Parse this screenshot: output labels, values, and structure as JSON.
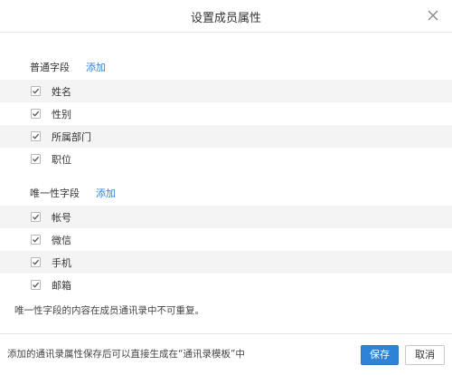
{
  "dialog": {
    "title": "设置成员属性"
  },
  "common_fields": {
    "heading": "普通字段",
    "add_label": "添加",
    "items": [
      {
        "label": "姓名",
        "checked": true
      },
      {
        "label": "性别",
        "checked": true
      },
      {
        "label": "所属部门",
        "checked": true
      },
      {
        "label": "职位",
        "checked": true
      }
    ]
  },
  "unique_fields": {
    "heading": "唯一性字段",
    "add_label": "添加",
    "items": [
      {
        "label": "帐号",
        "checked": true
      },
      {
        "label": "微信",
        "checked": true
      },
      {
        "label": "手机",
        "checked": true
      },
      {
        "label": "邮箱",
        "checked": true
      }
    ]
  },
  "note": "唯一性字段的内容在成员通讯录中不可重复。",
  "footer": {
    "text": "添加的通讯录属性保存后可以直接生成在“通讯录模板”中",
    "save_label": "保存",
    "cancel_label": "取消"
  },
  "colors": {
    "accent": "#2f83d6",
    "row_stripe": "#f4f4f4"
  }
}
